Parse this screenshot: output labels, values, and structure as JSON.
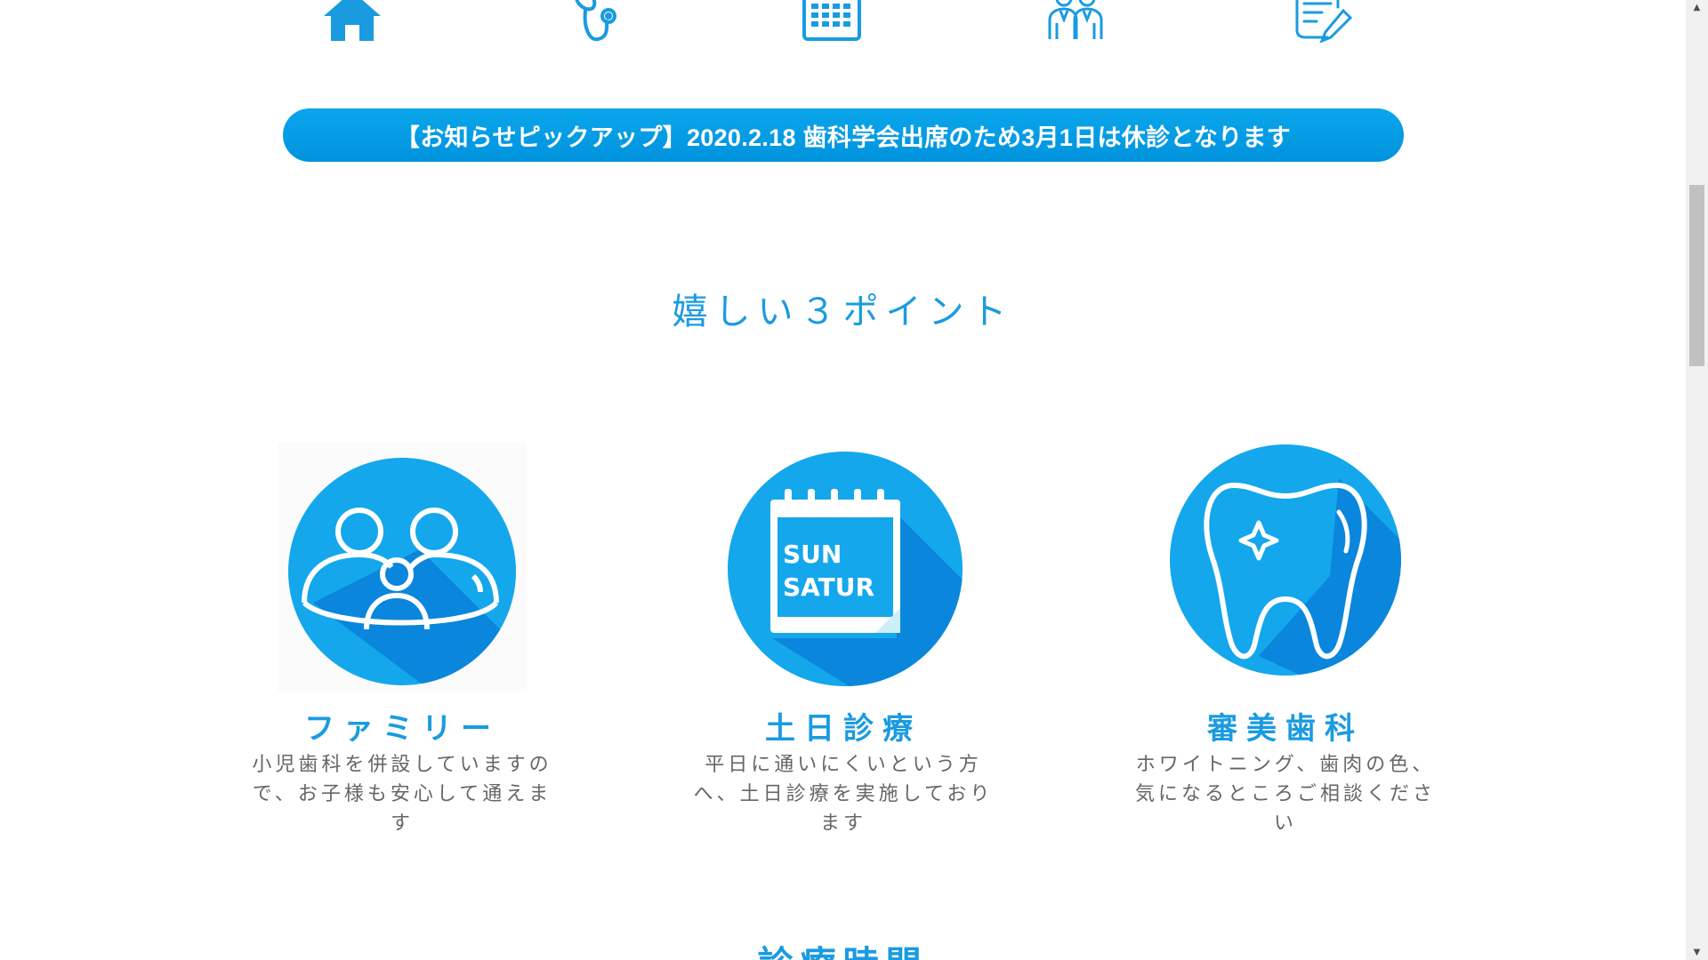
{
  "nav_icons": [
    {
      "name": "home-icon"
    },
    {
      "name": "stethoscope-icon"
    },
    {
      "name": "calendar-icon"
    },
    {
      "name": "doctors-icon"
    },
    {
      "name": "document-edit-icon"
    }
  ],
  "notice": {
    "text": "【お知らせピックアップ】2020.2.18 歯科学会出席のため3月1日は休診となります"
  },
  "section": {
    "title": "嬉しい３ポイント"
  },
  "features": [
    {
      "icon": "family-icon",
      "title": "ファミリー",
      "desc": "小児歯科を併設していますので、お子様も安心して通えます"
    },
    {
      "icon": "calendar-sun-satur-icon",
      "icon_text_1": "SUN",
      "icon_text_2": "SATUR",
      "title": "土日診療",
      "desc": "平日に通いにくいという方へ、土日診療を実施しております"
    },
    {
      "icon": "tooth-icon",
      "title": "審美歯科",
      "desc": "ホワイトニング、歯肉の色、気になるところご相談ください"
    }
  ],
  "next_section": {
    "title": "診療時間"
  },
  "colors": {
    "accent": "#1a9be0",
    "banner": "#0ba6ec",
    "highlight": "#fff23a",
    "circle": "#14a7ec",
    "shadow": "#0a86dc"
  }
}
